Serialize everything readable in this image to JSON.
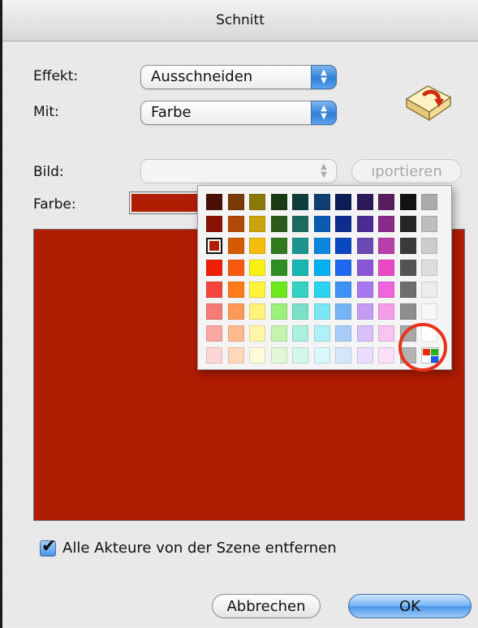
{
  "dialog": {
    "title": "Schnitt"
  },
  "effect": {
    "label": "Effekt:",
    "value": "Ausschneiden"
  },
  "with": {
    "label": "Mit:",
    "value": "Farbe"
  },
  "image": {
    "label": "Bild:",
    "value": "",
    "import_label": "ıportieren"
  },
  "color": {
    "label": "Farbe:",
    "value_hex": "#b01c00"
  },
  "palette": {
    "selected_row": 2,
    "selected_col": 0,
    "rows": [
      [
        "#4a0f06",
        "#7a3a06",
        "#8a7a08",
        "#1a3a14",
        "#103e3a",
        "#0f3e73",
        "#0a1e55",
        "#2e1a58",
        "#5a1e5e",
        "#121212",
        "#ababab"
      ],
      [
        "#891204",
        "#b04a06",
        "#c8a40a",
        "#2a5a1c",
        "#1e6a60",
        "#0b5bb3",
        "#0d2d8e",
        "#4c2b93",
        "#8a2a8a",
        "#262626",
        "#bdbdbd"
      ],
      [
        "#b21c00",
        "#d45a06",
        "#f3bd0a",
        "#337a1e",
        "#1e948e",
        "#0a86dc",
        "#0a48c2",
        "#6a49b4",
        "#b840aa",
        "#3a3a3a",
        "#cdcdcd"
      ],
      [
        "#f01e06",
        "#f65a10",
        "#f9f014",
        "#2f8e22",
        "#19b5b0",
        "#06aef2",
        "#1e68f0",
        "#8a55d8",
        "#ea49c4",
        "#545454",
        "#dddddd"
      ],
      [
        "#f5453c",
        "#ff7a1a",
        "#fff43a",
        "#6ee81e",
        "#35d2c4",
        "#2cd2f0",
        "#3e92f6",
        "#a679f0",
        "#f064dc",
        "#6e6e6e",
        "#ececec"
      ],
      [
        "#f77a76",
        "#ff9a56",
        "#fff27a",
        "#9df07a",
        "#7ae0c8",
        "#7ce6f4",
        "#76b4f6",
        "#c49cf4",
        "#f59ce8",
        "#8e8e8e",
        "#f8f8f8"
      ],
      [
        "#faa8a4",
        "#ffbb8c",
        "#fff6aa",
        "#c4f4b0",
        "#aaf0dc",
        "#b0f0f8",
        "#a8cdf8",
        "#d8c0f8",
        "#f8c4f0",
        "#a8a8a8",
        "#ffffff"
      ],
      [
        "#fcd6d4",
        "#ffd8bc",
        "#fffad8",
        "#e0f8d8",
        "#d2f8ec",
        "#d8f8fc",
        "#d4e6fc",
        "#eadcfc",
        "#fce0f8",
        "#b4b4b4",
        null
      ]
    ],
    "picker_icon": "color-picker-icon",
    "highlight_color": "#e8321a"
  },
  "remove_actors": {
    "label": "Alle Akteure von der Szene entfernen",
    "checked": true
  },
  "buttons": {
    "cancel": "Abbrechen",
    "ok": "OK"
  }
}
